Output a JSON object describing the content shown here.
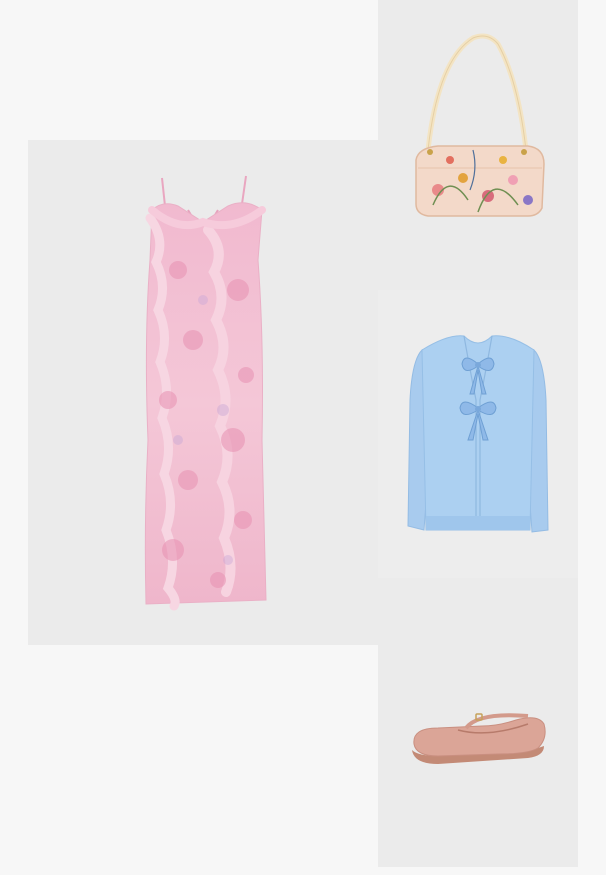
{
  "outfit": {
    "items": [
      {
        "id": "dress",
        "kind": "floral ruffle slip midi dress",
        "color": "#f0b7cc"
      },
      {
        "id": "bag",
        "kind": "floral print shoulder bag",
        "color": "#f3d7c6"
      },
      {
        "id": "cardigan",
        "kind": "light blue tie-front cardigan",
        "color": "#a9cdef"
      },
      {
        "id": "flats",
        "kind": "blush pink mary jane flats",
        "color": "#d8a092"
      }
    ],
    "colors": {
      "page_background": "#f7f7f7",
      "tile_background": "#ebebeb"
    }
  }
}
